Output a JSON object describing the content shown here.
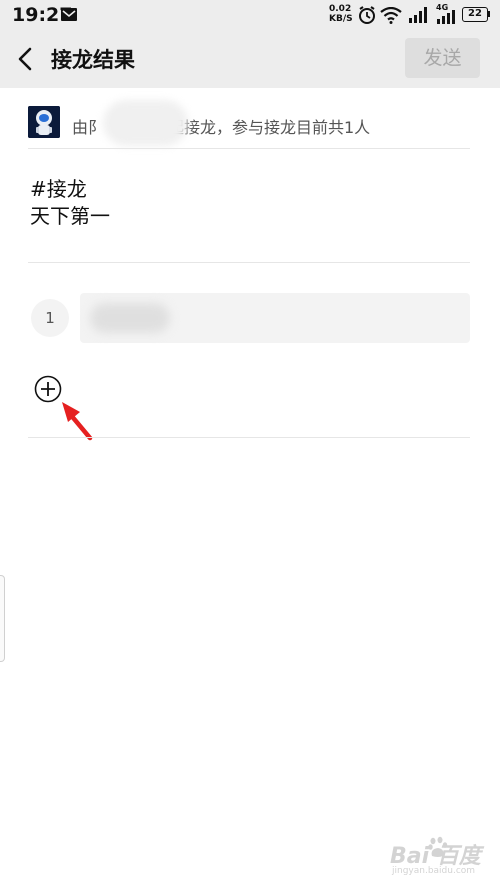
{
  "status_bar": {
    "time": "19:27",
    "net_speed_value": "0.02",
    "net_speed_unit": "KB/S",
    "network_label": "4G",
    "battery": "22"
  },
  "header": {
    "title": "接龙结果",
    "send_label": "发送"
  },
  "info": {
    "text": "由阝　　　　起接龙，参与接龙目前共1人"
  },
  "content": {
    "line1": "#接龙",
    "line2": "天下第一"
  },
  "entries": [
    {
      "index": "1"
    }
  ],
  "colors": {
    "header_bg": "#ededed",
    "arrow": "#e52020"
  },
  "watermark": {
    "main": "Bai  百度",
    "sub": "jingyan.baidu.com"
  }
}
